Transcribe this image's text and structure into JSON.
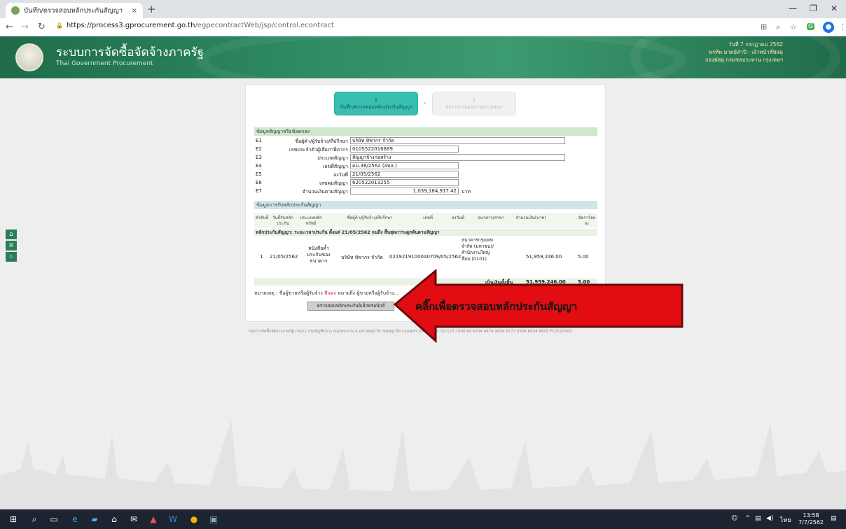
{
  "browser": {
    "tab_title": "บันทึก/ตรวจสอบหลักประกันสัญญา",
    "close_tab": "×",
    "new_tab": "+",
    "url_host": "https://process3.gprocurement.go.th",
    "url_path": "/egpecontractWeb/jsp/control.econtract"
  },
  "header": {
    "title": "ระบบการจัดซื้อจัดจ้างภาครัฐ",
    "subtitle": "Thai Government Procurement",
    "user_line1": "วันที่ 7 กรกฎาคม 2562",
    "user_line2": "พรทิพ มาตย์คำปี : เจ้าหน้าที่พัสดุ",
    "user_line3": "กองพัสดุ กรมชลประทาน กรุงเทพฯ"
  },
  "steps": [
    {
      "num": "1",
      "label": "บันทึก/ตรวจสอบหลักประกันสัญญา"
    },
    {
      "num": "2",
      "label": "ส่งรายงานผลการตรวจสอบ"
    }
  ],
  "section1": {
    "title": "ข้อมูลสัญญาหรือข้อตกลง",
    "fields": [
      {
        "code": "E1",
        "label": "ชื่อผู้ค้า/ผู้รับจ้าง/ที่ปรึกษา",
        "value": "บริษัท ทิพากร จำกัด"
      },
      {
        "code": "E2",
        "label": "เลขประจำตัวผู้เสียภาษีอากร",
        "value": "0105522016689"
      },
      {
        "code": "E3",
        "label": "ประเภทสัญญา",
        "value": "สัญญาจ้างก่อสร้าง"
      },
      {
        "code": "E4",
        "label": "เลขที่สัญญา",
        "value": "คม.38/2562 (สทล.)"
      },
      {
        "code": "E5",
        "label": "ลงวันที่",
        "value": "21/05/2562"
      },
      {
        "code": "E6",
        "label": "เลขคุมสัญญา",
        "value": "620522013255"
      },
      {
        "code": "E7",
        "label": "จำนวนเงินตามสัญญา",
        "value": "1,039,184,917.42",
        "unit": "บาท"
      }
    ]
  },
  "section2": {
    "title": "ข้อมูลการรับหลักประกันสัญญา",
    "columns": [
      "ลำดับที่",
      "วันที่รับหลักประกัน",
      "ประเภทหลักทรัพย์",
      "ชื่อผู้ค้า/ผู้รับจ้าง/ที่ปรึกษา",
      "เลขที่",
      "ลงวันที่",
      "ธนาคาร/สาขา",
      "จำนวนเงิน(บาท)",
      "อัตราร้อยละ"
    ],
    "group_text": "หลักประกันสัญญา: ระยะเวลาประกัน ตั้งแต่ 21/05/2562 จนถึง สิ้นสุดภาระผูกพันตามสัญญา",
    "row": {
      "no": "1",
      "date": "21/05/2562",
      "type": "หนังสือค้ำประกันของธนาคาร",
      "name": "บริษัท ทิพากร จำกัด",
      "number": "02192191000407",
      "dated": "09/05/2562",
      "bank": "ธนาคารกรุงเทพ จำกัด (มหาชน)/สำนักงานใหญ่สีลม (0101)",
      "amount": "51,959,246.00",
      "percent": "5.00"
    },
    "total_label": "เป็นเงินทั้งสิ้น",
    "total_amount": "51,959,246.00",
    "total_percent": "5.00"
  },
  "note": {
    "prefix": "หมายเหตุ : ชื่อผู้ขายหรือผู้รับจ้าง",
    "highlight": "สีแดง",
    "suffix": "หมายถึง ผู้ขายหรือผู้รับจ้าง..."
  },
  "verify_button": "ตรวจสอบหลักประกันอิเล็กทรอนิกส์",
  "callout_text": "คลิ๊กเพื่อตรวจสอบหลักประกันสัญญา",
  "footer": "กองการจัดซื้อจัดจ้างภาครัฐ (กจภ.) กรมบัญชีกลาง ถนนพระราม 6 แขวงพญาไท เขตพญาไท กรุงเทพฯ 10400 โทร. 02-127-7000 ต่อ 6704 4674 4958 6777 6938 6934 6800 FC0520000",
  "taskbar": {
    "time": "13:58",
    "date": "7/7/2562",
    "lang": "ไทย"
  },
  "colors": {
    "header_green": "#2e8a62",
    "step_active": "#38bfb0",
    "callout_red": "#e10d12",
    "section_bar": "#d1e6cf"
  }
}
